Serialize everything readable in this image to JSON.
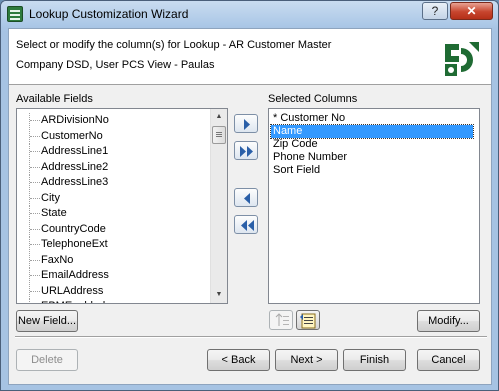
{
  "window": {
    "title": "Lookup Customization Wizard",
    "help_label": "?",
    "close_label": "✕"
  },
  "header": {
    "line1": "Select or modify the column(s) for Lookup - AR Customer Master",
    "line2": "Company DSD, User PCS View - Paulas"
  },
  "available_fields": {
    "label": "Available Fields",
    "items": [
      "ARDivisionNo",
      "CustomerNo",
      "AddressLine1",
      "AddressLine2",
      "AddressLine3",
      "City",
      "State",
      "CountryCode",
      "TelephoneExt",
      "FaxNo",
      "EmailAddress",
      "URLAddress",
      "EBMEnabled"
    ]
  },
  "selected_columns": {
    "label": "Selected Columns",
    "items": [
      "* Customer No",
      "Name",
      "Zip Code",
      "Phone Number",
      "Sort Field"
    ],
    "selected_index": 1
  },
  "buttons": {
    "new_field": "New Field...",
    "modify": "Modify...",
    "delete": "Delete",
    "back": "< Back",
    "next": "Next >",
    "finish": "Finish",
    "cancel": "Cancel"
  },
  "colors": {
    "selection": "#3399ff",
    "arrow_blue": "#2a5fa8",
    "logo_green": "#1f6b33"
  }
}
